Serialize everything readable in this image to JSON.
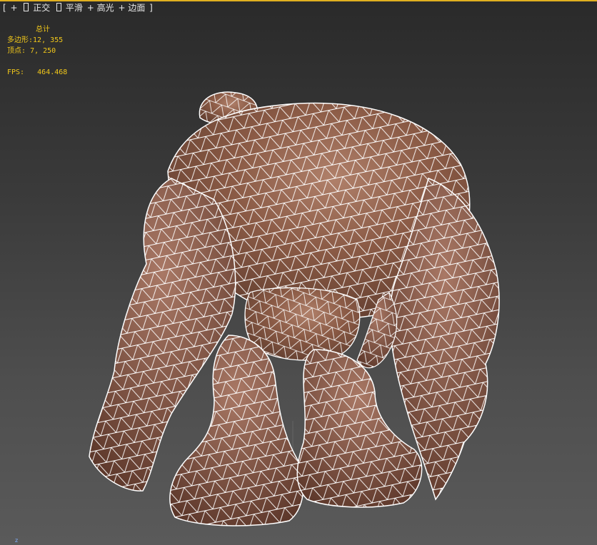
{
  "viewport": {
    "menu": {
      "bracket_open": "[",
      "plus": "+",
      "view_name": "正交",
      "shading": "平滑",
      "highlights": "+ 高光",
      "edged_faces": "+ 边面",
      "bracket_close": "]"
    },
    "stats": {
      "header": "总计",
      "polygons_label": "多边形:",
      "polygons_value": "12, 355",
      "vertices_label": "顶点:",
      "vertices_value": "7, 250",
      "fps_label": "FPS:",
      "fps_value": "464.468"
    },
    "axis_label": "z",
    "colors": {
      "stats_text": "#f2c81a",
      "wire": "#ffffff",
      "skin": "#8a5a45",
      "frame_accent": "#e0b020"
    }
  }
}
